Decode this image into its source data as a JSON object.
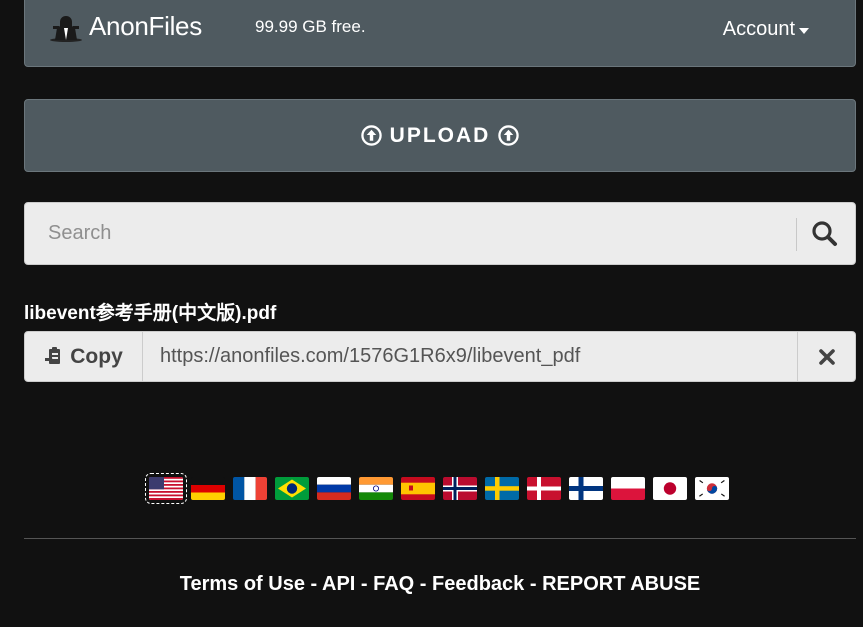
{
  "navbar": {
    "brand": "AnonFiles",
    "free_space": "99.99 GB free.",
    "account_label": "Account",
    "logo_icon": "hooded-figure-icon"
  },
  "upload": {
    "label": "UPLOAD",
    "icon": "circle-arrow-up-icon"
  },
  "search": {
    "placeholder": "Search",
    "value": "",
    "icon": "search-icon"
  },
  "file": {
    "title": "libevent参考手册(中文版).pdf",
    "copy_label": "Copy",
    "copy_icon": "clipboard-icon",
    "link": "https://anonfiles.com/1576G1R6x9/libevent_pdf",
    "close_icon": "close-icon"
  },
  "languages": [
    {
      "code": "us",
      "selected": true
    },
    {
      "code": "de"
    },
    {
      "code": "fr"
    },
    {
      "code": "br"
    },
    {
      "code": "ru"
    },
    {
      "code": "in"
    },
    {
      "code": "es"
    },
    {
      "code": "no"
    },
    {
      "code": "se"
    },
    {
      "code": "dk"
    },
    {
      "code": "fi"
    },
    {
      "code": "pl"
    },
    {
      "code": "jp"
    },
    {
      "code": "kr"
    }
  ],
  "footer": {
    "links": [
      "Terms of Use",
      "API",
      "FAQ",
      "Feedback",
      "REPORT ABUSE"
    ],
    "separator": " - "
  },
  "colors": {
    "background": "#111111",
    "panel": "#4f5a60",
    "input_bg": "#ececec"
  }
}
